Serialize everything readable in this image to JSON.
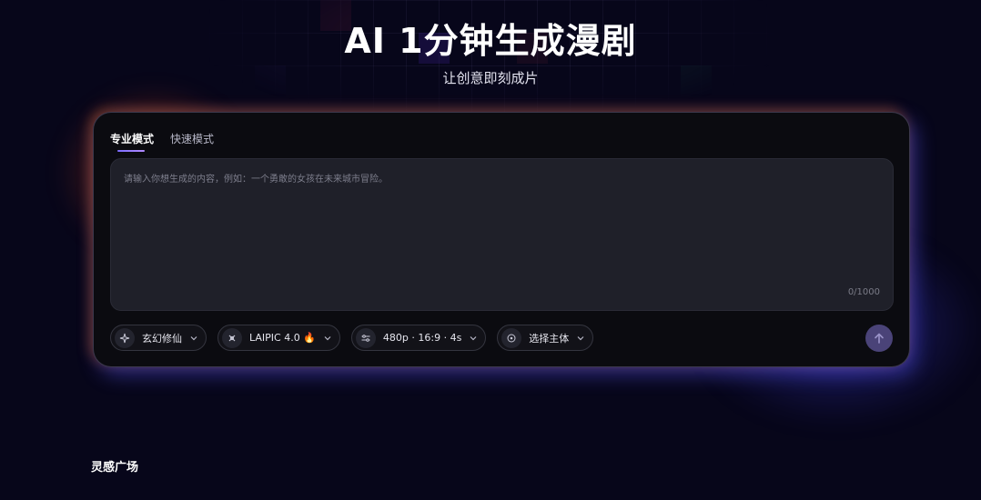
{
  "hero": {
    "title": "AI 1分钟生成漫剧",
    "subtitle": "让创意即刻成片"
  },
  "card": {
    "tabs": [
      {
        "label": "专业模式",
        "active": true
      },
      {
        "label": "快速模式",
        "active": false
      }
    ],
    "prompt": {
      "value": "",
      "placeholder": "请输入你想生成的内容，例如：一个勇敢的女孩在未来城市冒险。",
      "counter": "0/1000"
    },
    "toolbar": {
      "style_label": "玄幻修仙",
      "style_icon": "sparkle-icon",
      "model_label": "LAIPIC 4.0 🔥",
      "model_icon": "model-icon",
      "params_label": "480p · 16:9 · 4s",
      "params_icon": "sliders-icon",
      "subject_label": "选择主体",
      "subject_icon": "subject-icon"
    },
    "send_icon": "arrow-up-icon"
  },
  "section": {
    "title": "灵感广场"
  },
  "colors": {
    "background": "#07061a",
    "card": "#0b0b10",
    "input": "#1f2029",
    "accent": "#7b6cff",
    "send_button": "#4a4378",
    "glow_orange": "#ff6e28",
    "glow_blue": "#5050ff"
  }
}
